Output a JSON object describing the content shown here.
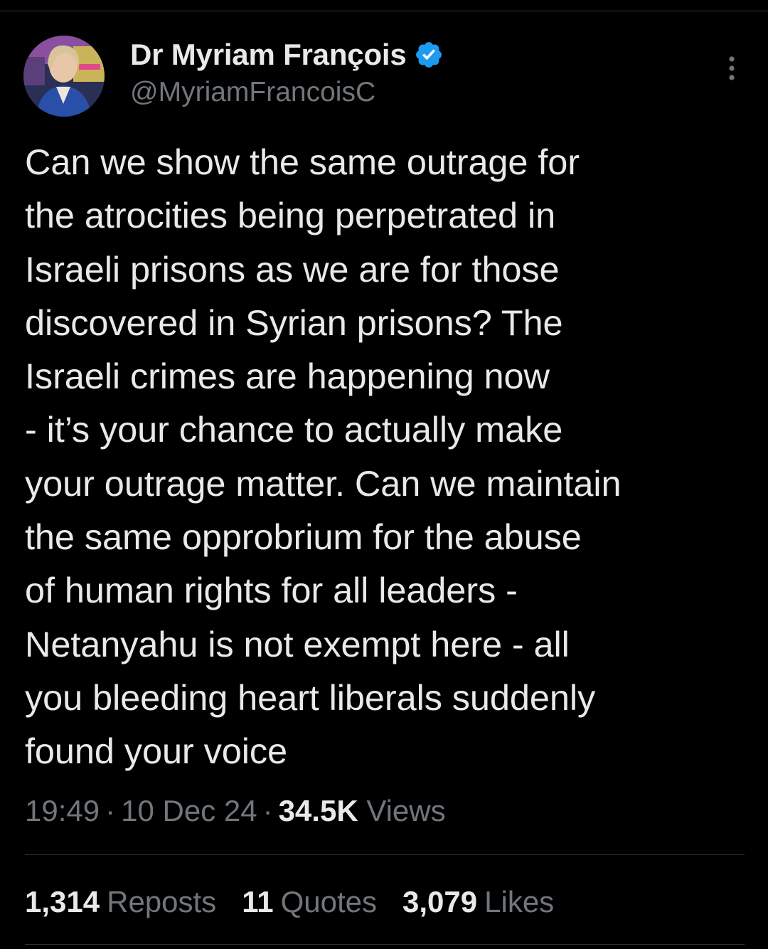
{
  "author": {
    "display_name": "Dr Myriam François",
    "handle": "@MyriamFrancoisC",
    "verified": true,
    "verified_color": "#1d9bf0"
  },
  "tweet": {
    "lines": [
      "Can we show the same outrage for",
      "the atrocities being perpetrated in",
      "Israeli prisons as we are for those",
      "discovered in Syrian prisons? The",
      "Israeli crimes are happening now",
      "- it’s your chance to actually make",
      "your outrage matter. Can we maintain",
      "the same opprobrium for the abuse",
      "of human rights for all leaders -",
      "Netanyahu is not exempt here - all",
      "you bleeding heart liberals suddenly",
      "found your voice"
    ]
  },
  "meta": {
    "time": "19:49",
    "date": "10 Dec 24",
    "views_count": "34.5K",
    "views_label": "Views",
    "separator": "·"
  },
  "stats": {
    "reposts": {
      "count": "1,314",
      "label": "Reposts"
    },
    "quotes": {
      "count": "11",
      "label": "Quotes"
    },
    "likes": {
      "count": "3,079",
      "label": "Likes"
    }
  },
  "icons": {
    "more": "more-vertical-icon",
    "verified": "verified-badge-icon"
  },
  "colors": {
    "background": "#000000",
    "text_primary": "#e7e9ea",
    "text_secondary": "#71767b",
    "divider": "#2f3336"
  }
}
